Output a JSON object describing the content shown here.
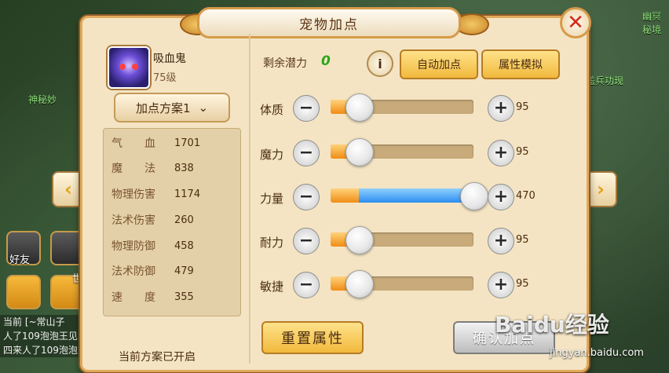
{
  "dialog": {
    "title": "宠物加点",
    "close_glyph": "✕"
  },
  "pet": {
    "name": "吸血鬼",
    "level": "75级"
  },
  "plan": {
    "label": "加点方案1",
    "status": "当前方案已开启"
  },
  "stats": [
    {
      "label": "气　　血",
      "value": "1701"
    },
    {
      "label": "魔　　法",
      "value": "838"
    },
    {
      "label": "物理伤害",
      "value": "1174"
    },
    {
      "label": "法术伤害",
      "value": "260"
    },
    {
      "label": "物理防御",
      "value": "458"
    },
    {
      "label": "法术防御",
      "value": "479"
    },
    {
      "label": "速　　度",
      "value": "355"
    }
  ],
  "potential": {
    "label": "剩余潜力",
    "value": "0"
  },
  "buttons": {
    "info": "i",
    "auto_assign": "自动加点",
    "simulate": "属性模拟",
    "reset": "重置属性",
    "confirm": "确认加点",
    "minus": "−",
    "plus": "+"
  },
  "attributes": [
    {
      "name": "体质",
      "value": "95",
      "fill": 0.2,
      "mode": "orange"
    },
    {
      "name": "魔力",
      "value": "95",
      "fill": 0.2,
      "mode": "orange"
    },
    {
      "name": "力量",
      "value": "470",
      "fill": 1.0,
      "mode": "blue"
    },
    {
      "name": "耐力",
      "value": "95",
      "fill": 0.2,
      "mode": "orange"
    },
    {
      "name": "敏捷",
      "value": "95",
      "fill": 0.2,
      "mode": "orange"
    }
  ],
  "background": {
    "chat_lines": [
      "当前 [~常山子",
      "人了109泡泡王见",
      "四来人了109泡泡"
    ],
    "friend_label": "好友",
    "world_label": "世",
    "map_text": [
      "幽冥秘境",
      "盖兵功现",
      "神秘妙"
    ]
  },
  "navigation": {
    "prev": "‹",
    "next": "›"
  },
  "watermark": {
    "brand": "Baidu经验",
    "url": "jingyan.baidu.com"
  },
  "colors": {
    "potential_value": "#2aa61a",
    "blue_fill": "#2c8ef0",
    "orange_fill": "#f08d16",
    "close_x": "#d42a1a"
  }
}
